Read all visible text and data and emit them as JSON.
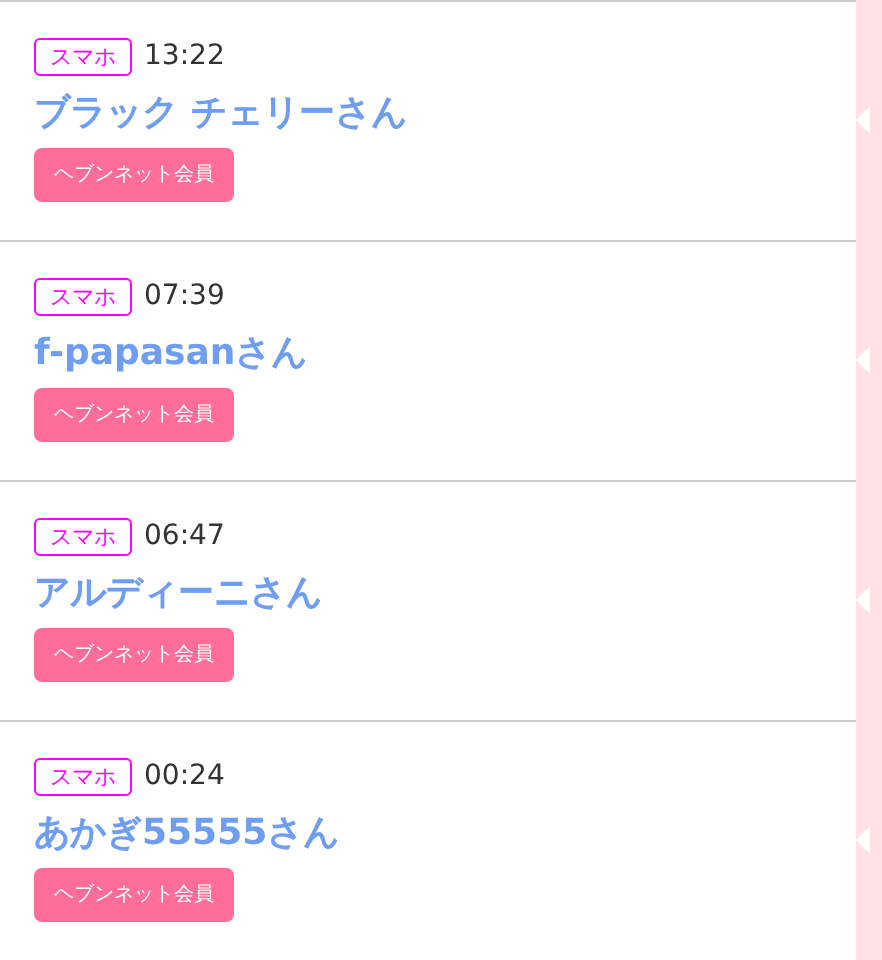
{
  "entries": [
    {
      "device": "スマホ",
      "time": "13:22",
      "name": "ブラック チェリーさん",
      "member_badge": "ヘブンネット会員"
    },
    {
      "device": "スマホ",
      "time": "07:39",
      "name": "f-papasanさん",
      "member_badge": "ヘブンネット会員"
    },
    {
      "device": "スマホ",
      "time": "06:47",
      "name": "アルディーニさん",
      "member_badge": "ヘブンネット会員"
    },
    {
      "device": "スマホ",
      "time": "00:24",
      "name": "あかぎ55555さん",
      "member_badge": "ヘブンネット会員"
    }
  ]
}
